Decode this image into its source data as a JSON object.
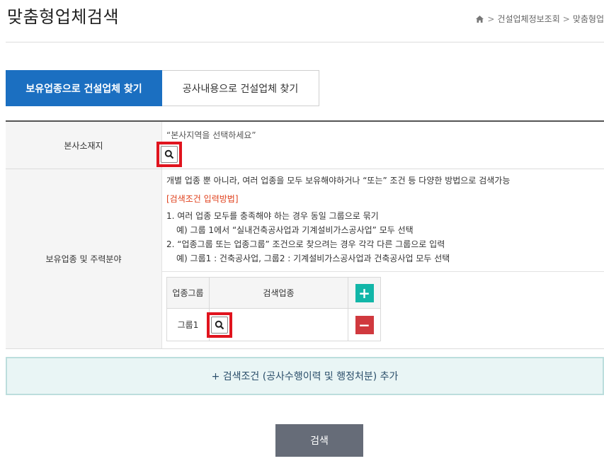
{
  "page": {
    "title": "맞춤형업체검색",
    "breadcrumb": [
      "건설업체정보조회",
      "맞춤형업"
    ]
  },
  "tabs": [
    {
      "label": "보유업종으로 건설업체 찾기",
      "active": true
    },
    {
      "label": "공사내용으로 건설업체 찾기",
      "active": false
    }
  ],
  "form": {
    "hq_location": {
      "label": "본사소재지",
      "hint": "“본사지역을 선택하세요”"
    },
    "business_types": {
      "label": "보유업종 및 주력분야",
      "intro": "개별 업종 뿐 아니라, 여러 업종을 모두 보유해야하거나 “또는” 조건 등 다양한 방법으로 검색가능",
      "method_title": "[검색조건 입력방법]",
      "steps": [
        "1. 여러 업종 모두를 충족해야 하는 경우 동일 그룹으로 묶기",
        "   예) 그룹 1에서 “실내건축공사업과 기계설비가스공사업” 모두 선택",
        "2. “업종그룹 또는 업종그룹” 조건으로 찾으려는 경우 각각 다른 그룹으로 입력",
        "   예) 그룹1 : 건축공사업, 그룹2 : 기계설비가스공사업과 건축공사업 모두 선택"
      ],
      "table": {
        "col_group": "업종그룹",
        "col_search": "검색업종",
        "rows": [
          {
            "group": "그룹1"
          }
        ]
      }
    }
  },
  "add_condition": "+ 검색조건 (공사수행이력 및 행정처분) 추가",
  "submit_label": "검색",
  "colors": {
    "accent": "#1b6fc1",
    "highlight": "#e0141e",
    "plus": "#12b6a8",
    "minus": "#d0393e",
    "submit": "#666c78"
  }
}
